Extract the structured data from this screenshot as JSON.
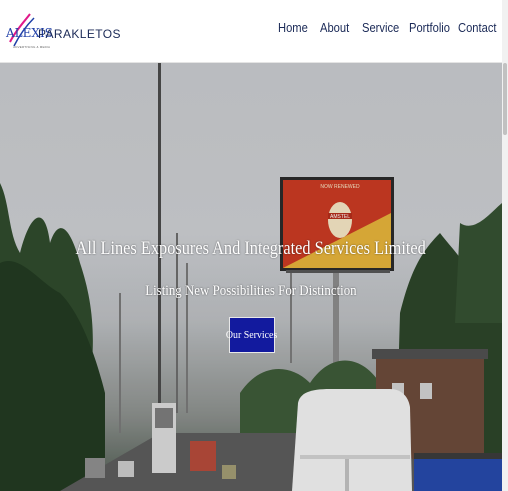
{
  "brand": {
    "logo_text": "ALEXIS",
    "logo_subtext": "ADVERTISING & MEDIA",
    "name": "PARAKLETOS"
  },
  "nav": {
    "items": [
      "Home",
      "About",
      "Service",
      "Portfolio",
      "Contact"
    ]
  },
  "hero": {
    "title": "All Lines Exposures And Integrated Services Limited",
    "subtitle": "Listing New Possibilities For Distinction",
    "cta_label": "Our Services",
    "billboard_top": "NOW RENEWED",
    "billboard_brand": "AMSTEL"
  },
  "colors": {
    "brand_blue": "#1b2a57",
    "logo_accent": "#e0198a",
    "cta_bg": "#121a9e",
    "billboard_red": "#c73a22"
  }
}
